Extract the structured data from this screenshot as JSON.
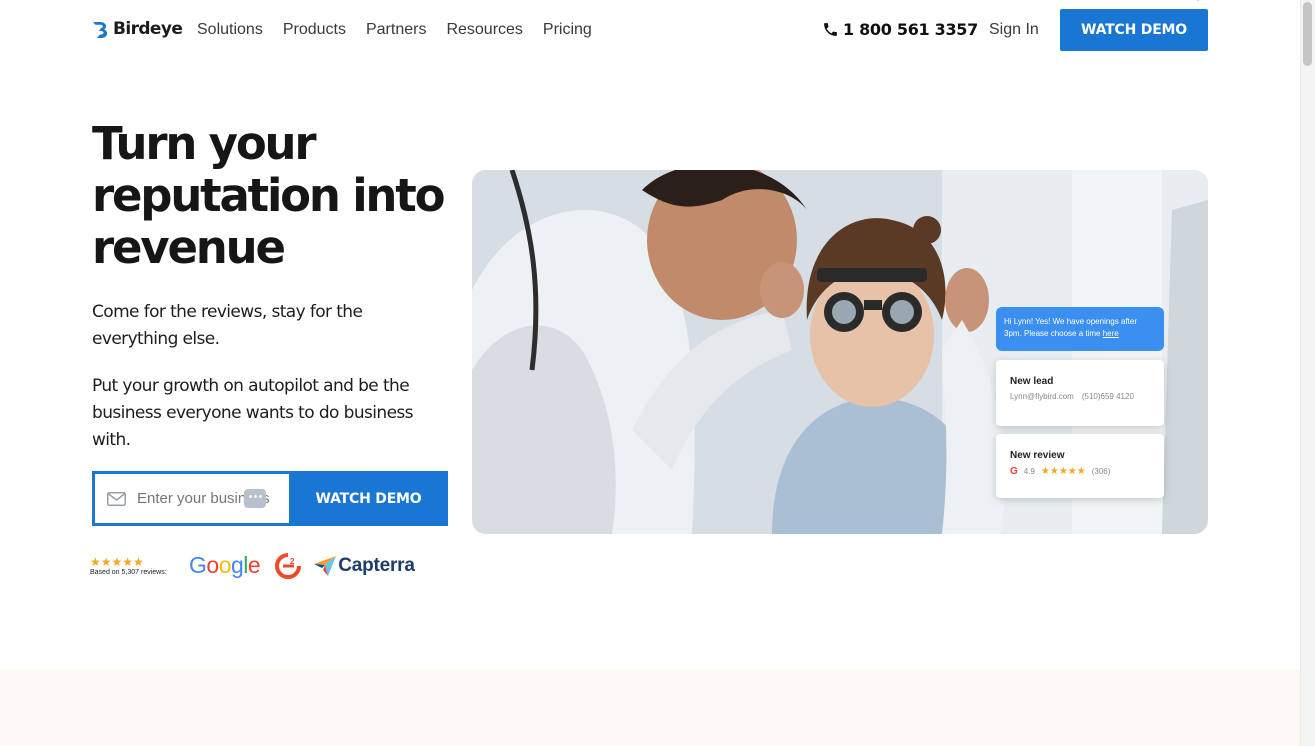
{
  "header": {
    "brand": "Birdeye",
    "nav": [
      "Solutions",
      "Products",
      "Partners",
      "Resources",
      "Pricing"
    ],
    "phone": "1 800 561 3357",
    "sign_in": "Sign In",
    "cta": "WATCH DEMO"
  },
  "hero": {
    "title": "Turn your reputation into revenue",
    "subtitle_1": "Come for the reviews, stay for the everything else.",
    "subtitle_2": "Put your growth on autopilot and be the business everyone wants to do business with.",
    "email_placeholder": "Enter your business email",
    "email_value": "",
    "form_cta": "WATCH DEMO",
    "dots_badge": "•••"
  },
  "trust": {
    "stars": "★★★★★",
    "rating_note": "Based on 5,307 reviews:",
    "google": [
      "G",
      "o",
      "o",
      "g",
      "l",
      "e"
    ],
    "google_colors": [
      "#4285F4",
      "#EA4335",
      "#FBBC05",
      "#4285F4",
      "#34A853",
      "#EA4335"
    ],
    "g2": "G2",
    "capterra": "Capterra"
  },
  "overlay": {
    "chat_text": "Hi Lynn! Yes! We have openings after 3pm. Please choose a time",
    "chat_link": "here",
    "lead_title": "New lead",
    "lead_email": "Lynn@flybird.com",
    "lead_phone": "(510)659 4120",
    "review_title": "New review",
    "review_source": "G",
    "review_rating": "4.9",
    "review_stars": "★★★★★",
    "review_count": "(306)"
  },
  "colors": {
    "accent": "#1976d2",
    "star": "#f5a623",
    "band": "#fdf8f4"
  }
}
